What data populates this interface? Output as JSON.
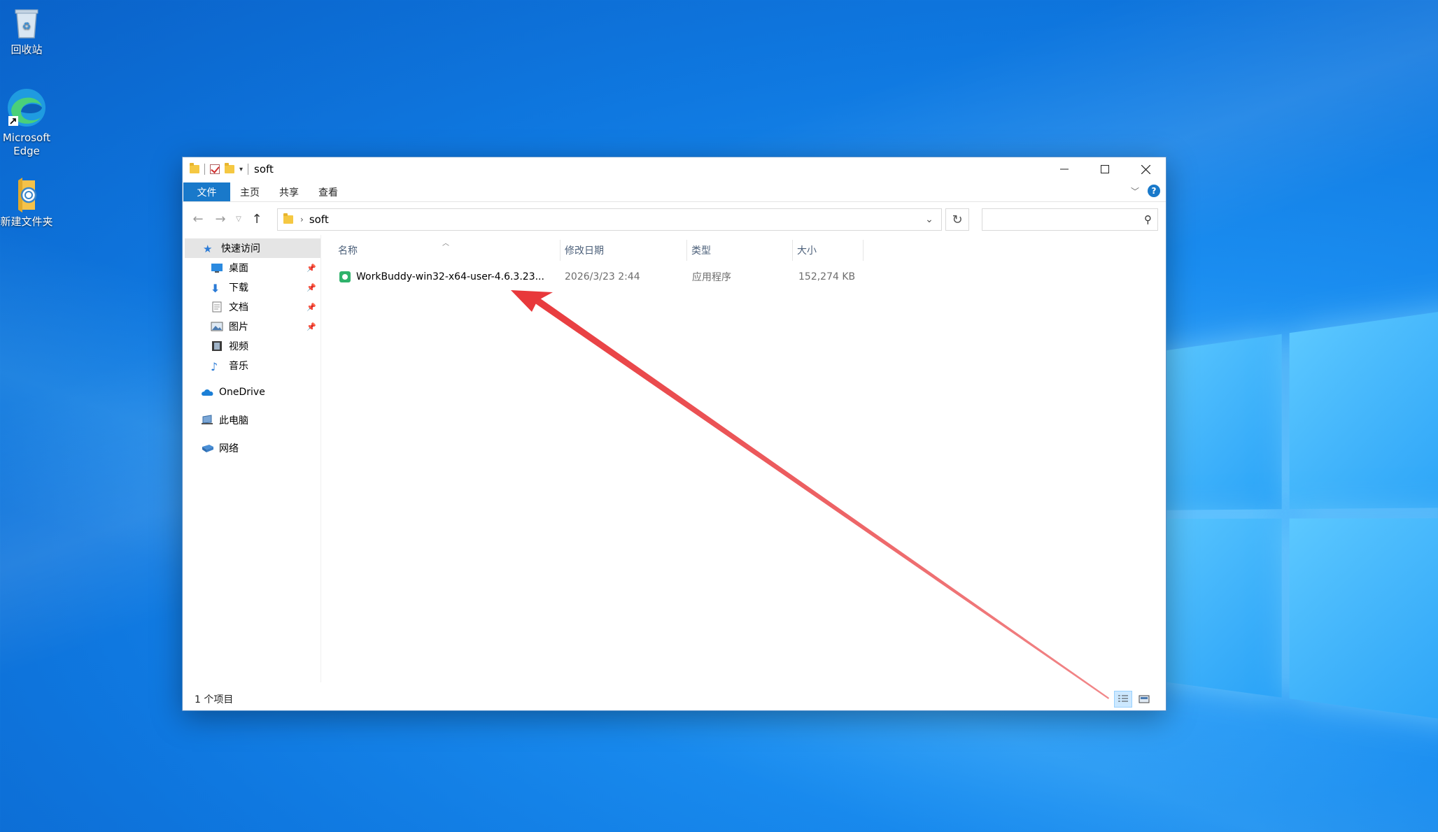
{
  "desktop": {
    "icons": [
      {
        "label": "回收站"
      },
      {
        "label": "Microsoft Edge"
      },
      {
        "label": "新建文件夹"
      }
    ]
  },
  "window": {
    "title": "soft",
    "caption": {
      "minimize": "—",
      "maximize": "☐",
      "close": "✕"
    }
  },
  "ribbon": {
    "tabs": [
      "文件",
      "主页",
      "共享",
      "查看"
    ],
    "help": "?"
  },
  "address": {
    "path": "soft",
    "search_placeholder": ""
  },
  "nav": {
    "quick_access": "快速访问",
    "items": [
      {
        "label": "桌面",
        "pinned": true
      },
      {
        "label": "下载",
        "pinned": true
      },
      {
        "label": "文档",
        "pinned": true
      },
      {
        "label": "图片",
        "pinned": true
      },
      {
        "label": "视频",
        "pinned": false
      },
      {
        "label": "音乐",
        "pinned": false
      }
    ],
    "onedrive": "OneDrive",
    "this_pc": "此电脑",
    "network": "网络"
  },
  "columns": {
    "name": "名称",
    "modified": "修改日期",
    "type": "类型",
    "size": "大小"
  },
  "files": [
    {
      "name": "WorkBuddy-win32-x64-user-4.6.3.23...",
      "modified": "2026/3/23 2:44",
      "type": "应用程序",
      "size": "152,274 KB"
    }
  ],
  "status": {
    "count": "1 个项目"
  },
  "colors": {
    "accent": "#1979ca",
    "annotation_arrow": "#e8383b"
  }
}
